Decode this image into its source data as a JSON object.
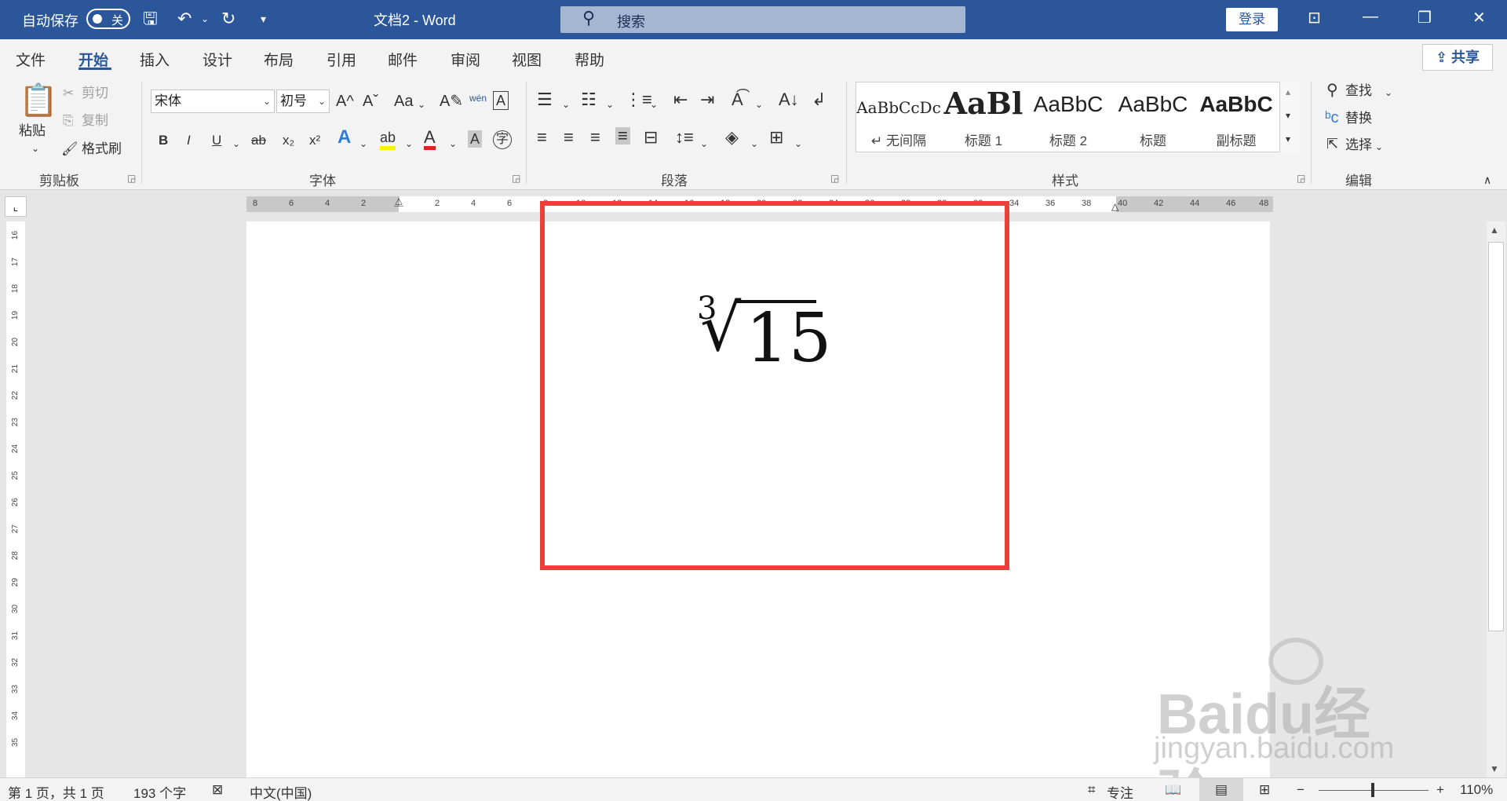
{
  "titlebar": {
    "autosave_label": "自动保存",
    "autosave_state": "关",
    "doc_title": "文档2  -  Word",
    "search_placeholder": "搜索",
    "login_label": "登录"
  },
  "menu": {
    "tabs": [
      "文件",
      "开始",
      "插入",
      "设计",
      "布局",
      "引用",
      "邮件",
      "审阅",
      "视图",
      "帮助"
    ],
    "active_tab": "开始",
    "share_label": "共享"
  },
  "ribbon": {
    "clipboard": {
      "paste": "粘贴",
      "cut": "剪切",
      "copy": "复制",
      "format_painter": "格式刷",
      "label": "剪贴板"
    },
    "font": {
      "font_name": "宋体",
      "font_size": "初号",
      "label": "字体",
      "bold": "B",
      "italic": "I",
      "underline": "U",
      "strike": "ab",
      "subscript": "x₂",
      "superscript": "x²",
      "change_case": "Aa",
      "grow": "A^",
      "shrink": "Aˇ",
      "phonetic": "wén",
      "text_effect": "A",
      "highlight": "ab",
      "font_color": "A",
      "char_shading": "A",
      "enclose": "字"
    },
    "paragraph": {
      "label": "段落"
    },
    "styles": {
      "label": "样式",
      "items": [
        {
          "preview": "AaBbCcDc",
          "name": "↵ 无间隔"
        },
        {
          "preview": "AaBl",
          "name": "标题 1"
        },
        {
          "preview": "AaBbC",
          "name": "标题 2"
        },
        {
          "preview": "AaBbC",
          "name": "标题"
        },
        {
          "preview": "AaBbC",
          "name": "副标题"
        }
      ]
    },
    "editing": {
      "find": "查找",
      "replace": "替换",
      "select": "选择",
      "label": "编辑"
    }
  },
  "ruler": {
    "h_left": [
      "8",
      "6",
      "4",
      "2"
    ],
    "h_right": [
      "2",
      "4",
      "6",
      "8",
      "10",
      "12",
      "14",
      "16",
      "18",
      "20",
      "22",
      "24",
      "26",
      "28",
      "30",
      "32",
      "34",
      "36",
      "38",
      "40",
      "42",
      "44",
      "46",
      "48"
    ],
    "v_numbers": [
      "16",
      "17",
      "18",
      "19",
      "20",
      "21",
      "22",
      "23",
      "24",
      "25",
      "26",
      "27",
      "28",
      "29",
      "30",
      "31",
      "32",
      "33",
      "34",
      "35"
    ]
  },
  "document": {
    "equation": {
      "index": "3",
      "radical": "√",
      "radicand": "15"
    }
  },
  "watermark": {
    "brand": "Baidu经验",
    "url": "jingyan.baidu.com"
  },
  "status": {
    "page_info": "第 1 页，共 1 页",
    "word_count": "193 个字",
    "language": "中文(中国)",
    "focus": "专注",
    "zoom": "110%",
    "zoom_level": 110
  },
  "colors": {
    "accent": "#2b579a",
    "highlight_box": "#e8403a"
  }
}
